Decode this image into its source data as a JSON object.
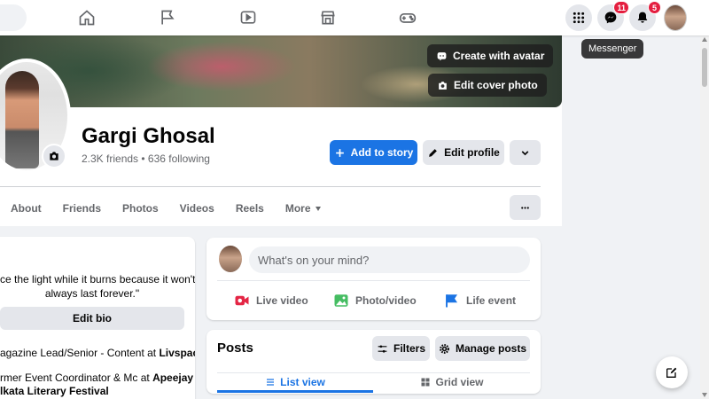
{
  "nav": {
    "icons": [
      "home-icon",
      "flag-icon",
      "video-icon",
      "marketplace-icon",
      "gaming-icon"
    ],
    "menu_icon": "grid-menu-icon",
    "messenger_badge": "11",
    "notifications_badge": "5",
    "tooltip": "Messenger"
  },
  "cover": {
    "create_avatar_label": "Create with avatar",
    "edit_cover_label": "Edit cover photo"
  },
  "profile": {
    "name": "Gargi Ghosal",
    "stats": "2.3K friends • 636 following",
    "add_story_label": "Add to story",
    "edit_profile_label": "Edit profile"
  },
  "tabs": [
    "About",
    "Friends",
    "Photos",
    "Videos",
    "Reels",
    "More"
  ],
  "intro": {
    "bio_line1": "ce the light while it burns because it won't",
    "bio_line2": "always last forever.\"",
    "edit_bio_label": "Edit bio",
    "work1_prefix": "agazine Lead/Senior - Content at ",
    "work1_org": "Livspace",
    "work2_prefix": "rmer Event Coordinator & Mc at ",
    "work2_org": "Apeejay",
    "work2_org_line2": "lkata Literary Festival"
  },
  "composer": {
    "placeholder": "What's on your mind?",
    "live_video": "Live video",
    "photo_video": "Photo/video",
    "life_event": "Life event"
  },
  "posts": {
    "title": "Posts",
    "filters_label": "Filters",
    "manage_label": "Manage posts",
    "list_view": "List view",
    "grid_view": "Grid view"
  },
  "colors": {
    "accent": "#1b74e4",
    "badge": "#e41e3f",
    "live_red": "#e42645",
    "photo_green": "#45bd62",
    "event_blue": "#1b74e4"
  }
}
